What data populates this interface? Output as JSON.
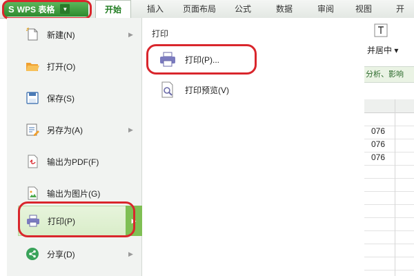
{
  "app": {
    "logo_glyph": "S",
    "name": "WPS 表格",
    "dropdown_glyph": "▼",
    "brand_color": "#3f9a3f"
  },
  "tabs": [
    {
      "label": "开始",
      "active": true
    },
    {
      "label": "插入"
    },
    {
      "label": "页面布局"
    },
    {
      "label": "公式"
    },
    {
      "label": "数据"
    },
    {
      "label": "审阅"
    },
    {
      "label": "视图"
    },
    {
      "label": "开"
    }
  ],
  "file_menu": {
    "items": [
      {
        "label": "新建(N)",
        "icon": "new-file-icon",
        "has_submenu": true
      },
      {
        "label": "打开(O)",
        "icon": "open-folder-icon",
        "has_submenu": false
      },
      {
        "label": "保存(S)",
        "icon": "save-icon",
        "has_submenu": false
      },
      {
        "label": "另存为(A)",
        "icon": "save-as-icon",
        "has_submenu": true
      },
      {
        "label": "输出为PDF(F)",
        "icon": "pdf-export-icon",
        "has_submenu": false
      },
      {
        "label": "输出为图片(G)",
        "icon": "image-export-icon",
        "has_submenu": false
      },
      {
        "label": "打印(P)",
        "icon": "printer-icon",
        "has_submenu": true,
        "selected": true
      },
      {
        "label": "分享(D)",
        "icon": "share-icon",
        "has_submenu": true
      }
    ],
    "arrow_glyph": "▶"
  },
  "print_submenu": {
    "title": "打印",
    "items": [
      {
        "label": "打印(P)...",
        "icon": "printer-icon"
      },
      {
        "label": "打印预览(V)",
        "icon": "print-preview-icon"
      }
    ]
  },
  "sheet_fragment": {
    "merge_label": "并居中 ▾",
    "analysis_text": "分析、影响",
    "cells": [
      "076",
      "076",
      "076"
    ]
  },
  "highlight_color": "#d9262c"
}
